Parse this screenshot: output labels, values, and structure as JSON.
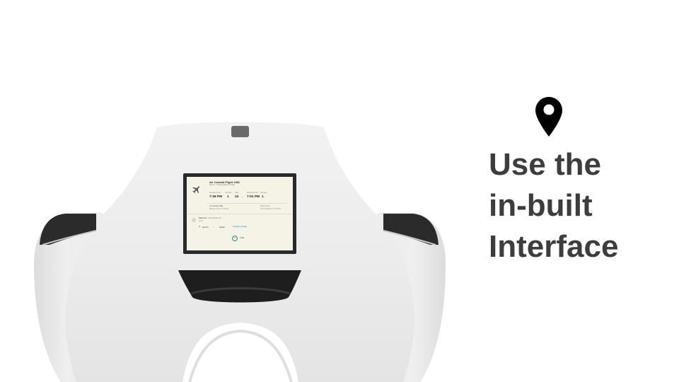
{
  "caption": {
    "line1": "Use the",
    "line2": "in-built",
    "line3": "Interface",
    "color": "#3d3d3d"
  },
  "pin_icon": "map-pin-icon",
  "screen": {
    "title": "Air Canada Flight 1981",
    "subtitle": "Sep 17 · Scotia Harbour Arrival",
    "dep_label": "Departs Arrival",
    "dep_time": "7:36 PM",
    "terminal_label": "Terminal",
    "terminal": "1",
    "gate_label": "Gate",
    "gate": "24",
    "arr_label": "Departs Arrival",
    "arr_time": "7:51 PM",
    "arr_terminal_label": "Terminal",
    "arr_terminal": "1",
    "flight2_title": "Air Canada 1981",
    "flight2_sub": "Baltimore Sep 17 7:36 PM",
    "flight2_right1": "Pittsburgh 36",
    "flight2_right2": "7:52 to 058 Sep 17 7:55 PM",
    "contact_name": "Kiwi.com",
    "contact_email": "mailbox@kiwi.com",
    "contact_sub": "to me",
    "lang_from": "Spanish",
    "lang_to": "English",
    "translate": "Translate message",
    "logo_mark": "KIWI",
    "logo_word": "COM"
  }
}
